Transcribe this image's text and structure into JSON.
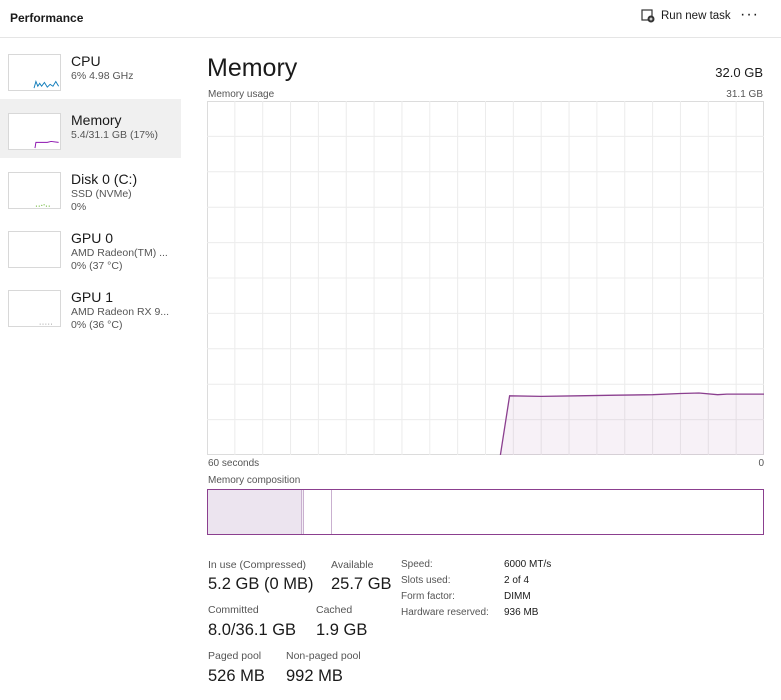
{
  "header": {
    "title": "Performance",
    "run_new_task": "Run new task",
    "more": "···"
  },
  "sidebar": {
    "items": [
      {
        "name": "CPU",
        "line1": "6% 4.98 GHz",
        "line2": "",
        "color": "#117dbb",
        "selected": false
      },
      {
        "name": "Memory",
        "line1": "5.4/31.1 GB (17%)",
        "line2": "",
        "color": "#8b12ae",
        "selected": true
      },
      {
        "name": "Disk 0 (C:)",
        "line1": "SSD (NVMe)",
        "line2": "0%",
        "color": "#4da60c",
        "selected": false
      },
      {
        "name": "GPU 0",
        "line1": "AMD Radeon(TM) ...",
        "line2": "0% (37 °C)",
        "color": "#a0a0a0",
        "selected": false
      },
      {
        "name": "GPU 1",
        "line1": "AMD Radeon RX 9...",
        "line2": "0% (36 °C)",
        "color": "#a0a0a0",
        "selected": false
      }
    ]
  },
  "main": {
    "title": "Memory",
    "total": "32.0 GB",
    "usage_label": "Memory usage",
    "usage_max": "31.1 GB",
    "time_left": "60 seconds",
    "time_right": "0",
    "composition_label": "Memory composition",
    "composition": {
      "in_use_fraction": 0.17,
      "modified_fraction": 0.004,
      "standby_fraction": 0.05
    },
    "stats": {
      "in_use_label": "In use (Compressed)",
      "in_use": "5.2 GB (0 MB)",
      "available_label": "Available",
      "available": "25.7 GB",
      "committed_label": "Committed",
      "committed": "8.0/36.1 GB",
      "cached_label": "Cached",
      "cached": "1.9 GB",
      "paged_label": "Paged pool",
      "paged": "526 MB",
      "nonpaged_label": "Non-paged pool",
      "nonpaged": "992 MB"
    },
    "details": [
      {
        "k": "Speed:",
        "v": "6000 MT/s"
      },
      {
        "k": "Slots used:",
        "v": "2 of 4"
      },
      {
        "k": "Form factor:",
        "v": "DIMM"
      },
      {
        "k": "Hardware reserved:",
        "v": "936 MB"
      }
    ]
  },
  "chart_data": {
    "type": "area",
    "title": "Memory usage",
    "xlabel": "60 seconds",
    "ylabel": "",
    "xlim": [
      60,
      0
    ],
    "ylim": [
      0,
      31.1
    ],
    "grid": true,
    "x": [
      28.4,
      27.4,
      24,
      20,
      16,
      12,
      9,
      7,
      5,
      4,
      0
    ],
    "values": [
      0,
      5.2,
      5.15,
      5.2,
      5.25,
      5.3,
      5.4,
      5.45,
      5.3,
      5.35,
      5.35
    ],
    "color": "#8b3f8f"
  }
}
